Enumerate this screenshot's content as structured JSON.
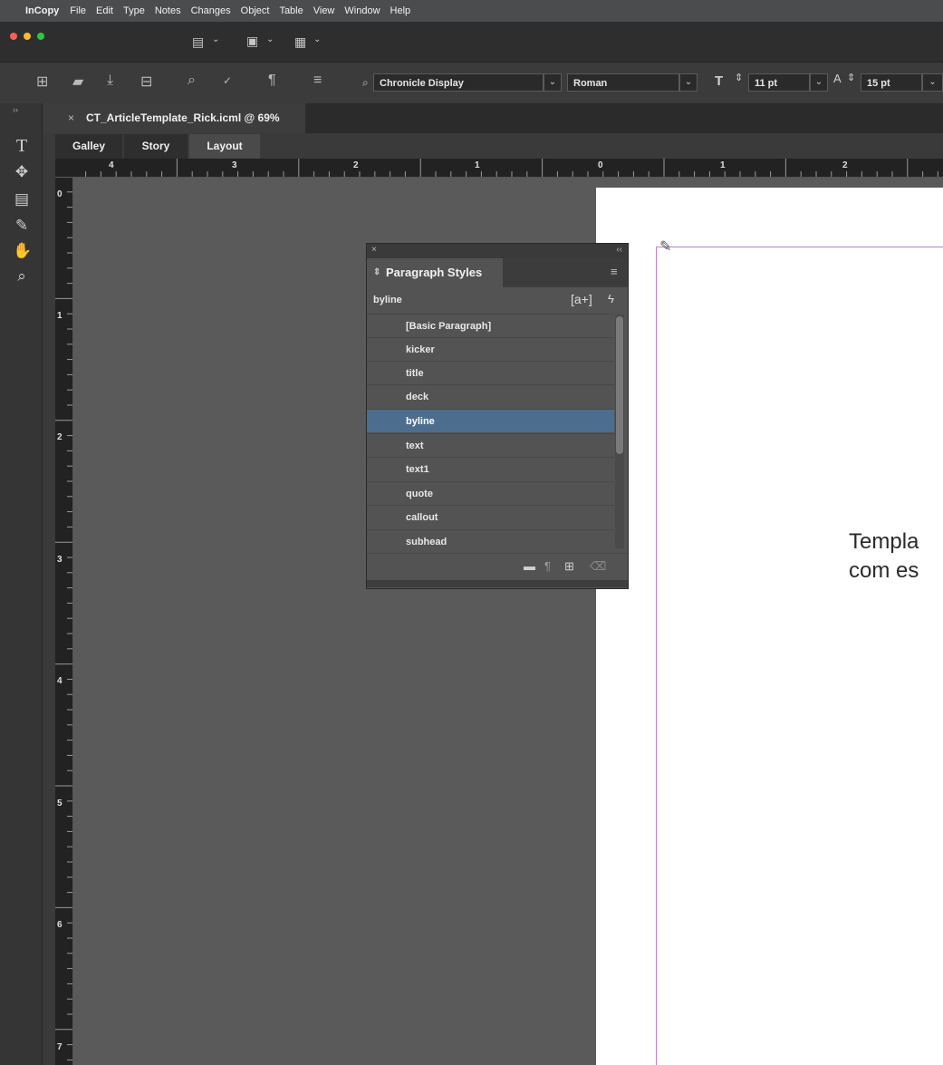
{
  "menubar": {
    "app_name": "InCopy",
    "items": [
      "File",
      "Edit",
      "Type",
      "Notes",
      "Changes",
      "Object",
      "Table",
      "View",
      "Window",
      "Help"
    ]
  },
  "control_bar": {
    "font_family": "Chronicle Display",
    "font_style": "Roman",
    "font_size": "11 pt",
    "leading": "15 pt"
  },
  "document": {
    "tab_title": "CT_ArticleTemplate_Rick.icml @ 69%",
    "view_tabs": [
      "Galley",
      "Story",
      "Layout"
    ],
    "active_view": "Layout"
  },
  "rulers": {
    "horizontal": [
      "4",
      "3",
      "2",
      "1",
      "0",
      "1",
      "2"
    ],
    "vertical": [
      "0",
      "1",
      "2",
      "3",
      "4",
      "5",
      "6",
      "7"
    ]
  },
  "page": {
    "text_line1": "Templa",
    "text_line2": "com es"
  },
  "paragraph_styles": {
    "panel_title": "Paragraph Styles",
    "current_style": "byline",
    "styles": [
      "[Basic Paragraph]",
      "kicker",
      "title",
      "deck",
      "byline",
      "text",
      "text1",
      "quote",
      "callout",
      "subhead"
    ],
    "selected": "byline"
  },
  "colors": {
    "selection": "#4d6d8f",
    "margin_guide": "#c77ad1",
    "pasteboard": "#5a5a5a"
  }
}
